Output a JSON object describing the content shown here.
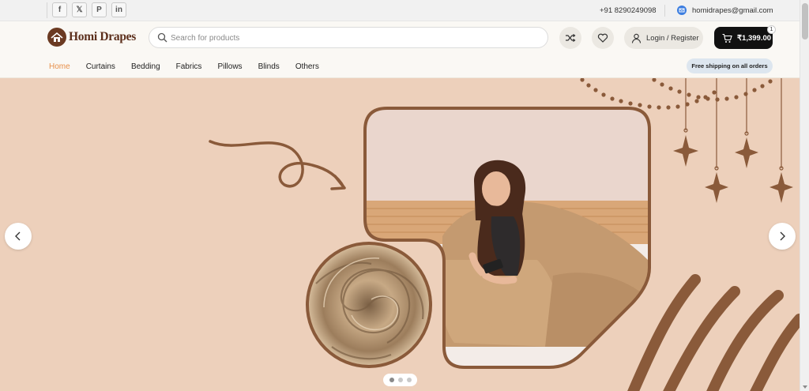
{
  "topbar": {
    "social": [
      {
        "icon": "facebook-icon",
        "glyph": "f"
      },
      {
        "icon": "x-twitter-icon",
        "glyph": "𝕏"
      },
      {
        "icon": "pinterest-icon",
        "glyph": "P"
      },
      {
        "icon": "linkedin-icon",
        "glyph": "in"
      }
    ],
    "phone": "+91 8290249098",
    "email": "homidrapes@gmail.com"
  },
  "header": {
    "logo_text": "Homi Drapes",
    "search_placeholder": "Search for products",
    "login_label": "Login / Register",
    "cart_total": "₹1,399.00",
    "cart_count": "1"
  },
  "nav": {
    "items": [
      "Home",
      "Curtains",
      "Bedding",
      "Fabrics",
      "Pillows",
      "Blinds",
      "Others"
    ],
    "active": "Home",
    "shipping_note": "Free shipping on all orders"
  },
  "hero": {
    "slide_count": 3,
    "active_slide": 1
  },
  "colors": {
    "accent": "#e8904a",
    "hero_bg": "#edd0bb",
    "brand_brown": "#8a5a3a",
    "cart_bg": "#111111"
  }
}
